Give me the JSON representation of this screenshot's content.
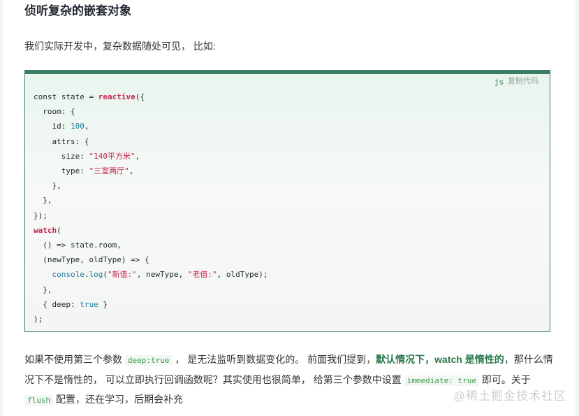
{
  "heading": "侦听复杂的嵌套对象",
  "intro": "我们实际开发中，复杂数据随处可见， 比如:",
  "code": {
    "lang": "js",
    "copy_label": "复制代码",
    "lines": [
      [
        [
          "const state = ",
          "kw"
        ],
        [
          "reactive",
          "fn"
        ],
        [
          "({",
          "kw"
        ]
      ],
      [
        [
          "  room: {",
          "kw"
        ]
      ],
      [
        [
          "    id: ",
          "kw"
        ],
        [
          "100",
          "num"
        ],
        [
          ",",
          "kw"
        ]
      ],
      [
        [
          "    attrs: {",
          "kw"
        ]
      ],
      [
        [
          "      size: ",
          "kw"
        ],
        [
          "\"140平方米\"",
          "str"
        ],
        [
          ",",
          "kw"
        ]
      ],
      [
        [
          "      type: ",
          "kw"
        ],
        [
          "\"三室两厅\"",
          "str"
        ],
        [
          ",",
          "kw"
        ]
      ],
      [
        [
          "    },",
          "kw"
        ]
      ],
      [
        [
          "  },",
          "kw"
        ]
      ],
      [
        [
          "});",
          "kw"
        ]
      ],
      [
        [
          "watch",
          "fn"
        ],
        [
          "(",
          "kw"
        ]
      ],
      [
        [
          "  () => state.room,",
          "kw"
        ]
      ],
      [
        [
          "  (newType, oldType) => {",
          "kw"
        ]
      ],
      [
        [
          "    ",
          "kw"
        ],
        [
          "console",
          "fn2"
        ],
        [
          ".",
          "kw"
        ],
        [
          "log",
          "fn2"
        ],
        [
          "(",
          "kw"
        ],
        [
          "\"新值:\"",
          "str"
        ],
        [
          ", newType, ",
          "kw"
        ],
        [
          "\"老值:\"",
          "str"
        ],
        [
          ", oldType);",
          "kw"
        ]
      ],
      [
        [
          "  },",
          "kw"
        ]
      ],
      [
        [
          "  { deep: ",
          "kw"
        ],
        [
          "true",
          "bool"
        ],
        [
          " }",
          "kw"
        ]
      ],
      [
        [
          ");",
          "kw"
        ]
      ]
    ]
  },
  "para": {
    "t1": "如果不使用第三个参数 ",
    "c1": "deep:true",
    "t2": " ， 是无法监听到数据变化的。 前面我们提到，",
    "s1": "默认情况下，watch 是惰性的",
    "t3": "，那什么情况下不是惰性的， 可以立即执行回调函数呢？其实使用也很简单， 给第三个参数中设置 ",
    "c2": "immediate: true",
    "t4": " 即可。关于 ",
    "c3": "flush",
    "t5": " 配置，还在学习，后期会补充"
  },
  "watermark": "@稀土掘金技术社区"
}
